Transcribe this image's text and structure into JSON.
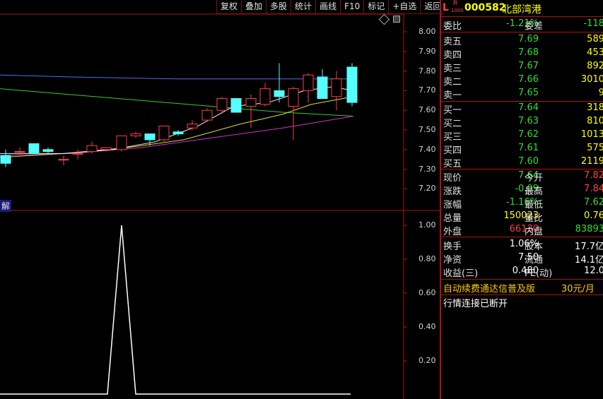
{
  "toolbar": {
    "items": [
      "复权",
      "叠加",
      "多股",
      "统计",
      "画线",
      "F10",
      "标记",
      "+自选",
      "返回"
    ]
  },
  "main_axis": {
    "ticks": [
      "8.00",
      "7.90",
      "7.80",
      "7.70",
      "7.60",
      "7.50",
      "7.40",
      "7.30",
      "7.20"
    ]
  },
  "sub_axis": {
    "ticks": [
      "1.00",
      "0.80",
      "0.60",
      "0.40",
      "0.20"
    ]
  },
  "sub_label": "解",
  "header": {
    "flag_l": "L",
    "flag_r": "R",
    "flag_small": "1000",
    "code": "000582",
    "name": "北部湾港"
  },
  "order_book": {
    "weibi_label": "委比",
    "weibi": "-1.21%",
    "weicha_label": "委差",
    "weicha": "-118",
    "asks": [
      {
        "label": "卖五",
        "price": "7.69",
        "vol": "589"
      },
      {
        "label": "卖四",
        "price": "7.68",
        "vol": "453"
      },
      {
        "label": "卖三",
        "price": "7.67",
        "vol": "892"
      },
      {
        "label": "卖二",
        "price": "7.66",
        "vol": "3010"
      },
      {
        "label": "卖一",
        "price": "7.65",
        "vol": "9"
      }
    ],
    "bids": [
      {
        "label": "买一",
        "price": "7.64",
        "vol": "318"
      },
      {
        "label": "买二",
        "price": "7.63",
        "vol": "810"
      },
      {
        "label": "买三",
        "price": "7.62",
        "vol": "1013"
      },
      {
        "label": "买四",
        "price": "7.61",
        "vol": "575"
      },
      {
        "label": "买五",
        "price": "7.60",
        "vol": "2119"
      }
    ]
  },
  "quote": {
    "rows": [
      {
        "l1": "现价",
        "v1": "7.64",
        "l2": "今开",
        "v2": "7.82"
      },
      {
        "l1": "涨跌",
        "v1": "-0.09",
        "l2": "最高",
        "v2": "7.84"
      },
      {
        "l1": "涨幅",
        "v1": "-1.16%",
        "l2": "最低",
        "v2": "7.62"
      },
      {
        "l1": "总量",
        "v1": "150023",
        "l2": "量比",
        "v2": "0.76"
      },
      {
        "l1": "外盘",
        "v1": "66130",
        "l2": "内盘",
        "v2": "83893"
      }
    ]
  },
  "fundamentals": {
    "rows": [
      {
        "l1": "换手",
        "v1": "1.06%",
        "l2": "股本",
        "v2": "17.7亿"
      },
      {
        "l1": "净资",
        "v1": "7.50",
        "l2": "流通",
        "v2": "14.1亿"
      },
      {
        "l1": "收益(三)",
        "v1": "0.480",
        "l2": "PE(动)",
        "v2": "12.0"
      }
    ]
  },
  "promo": {
    "text": "自动续费通达信普及版",
    "price": "30元/月"
  },
  "status": "行情连接已断开",
  "colors": {
    "up": "#ff4040",
    "down": "#55ffff",
    "grid": "#b01010"
  }
}
